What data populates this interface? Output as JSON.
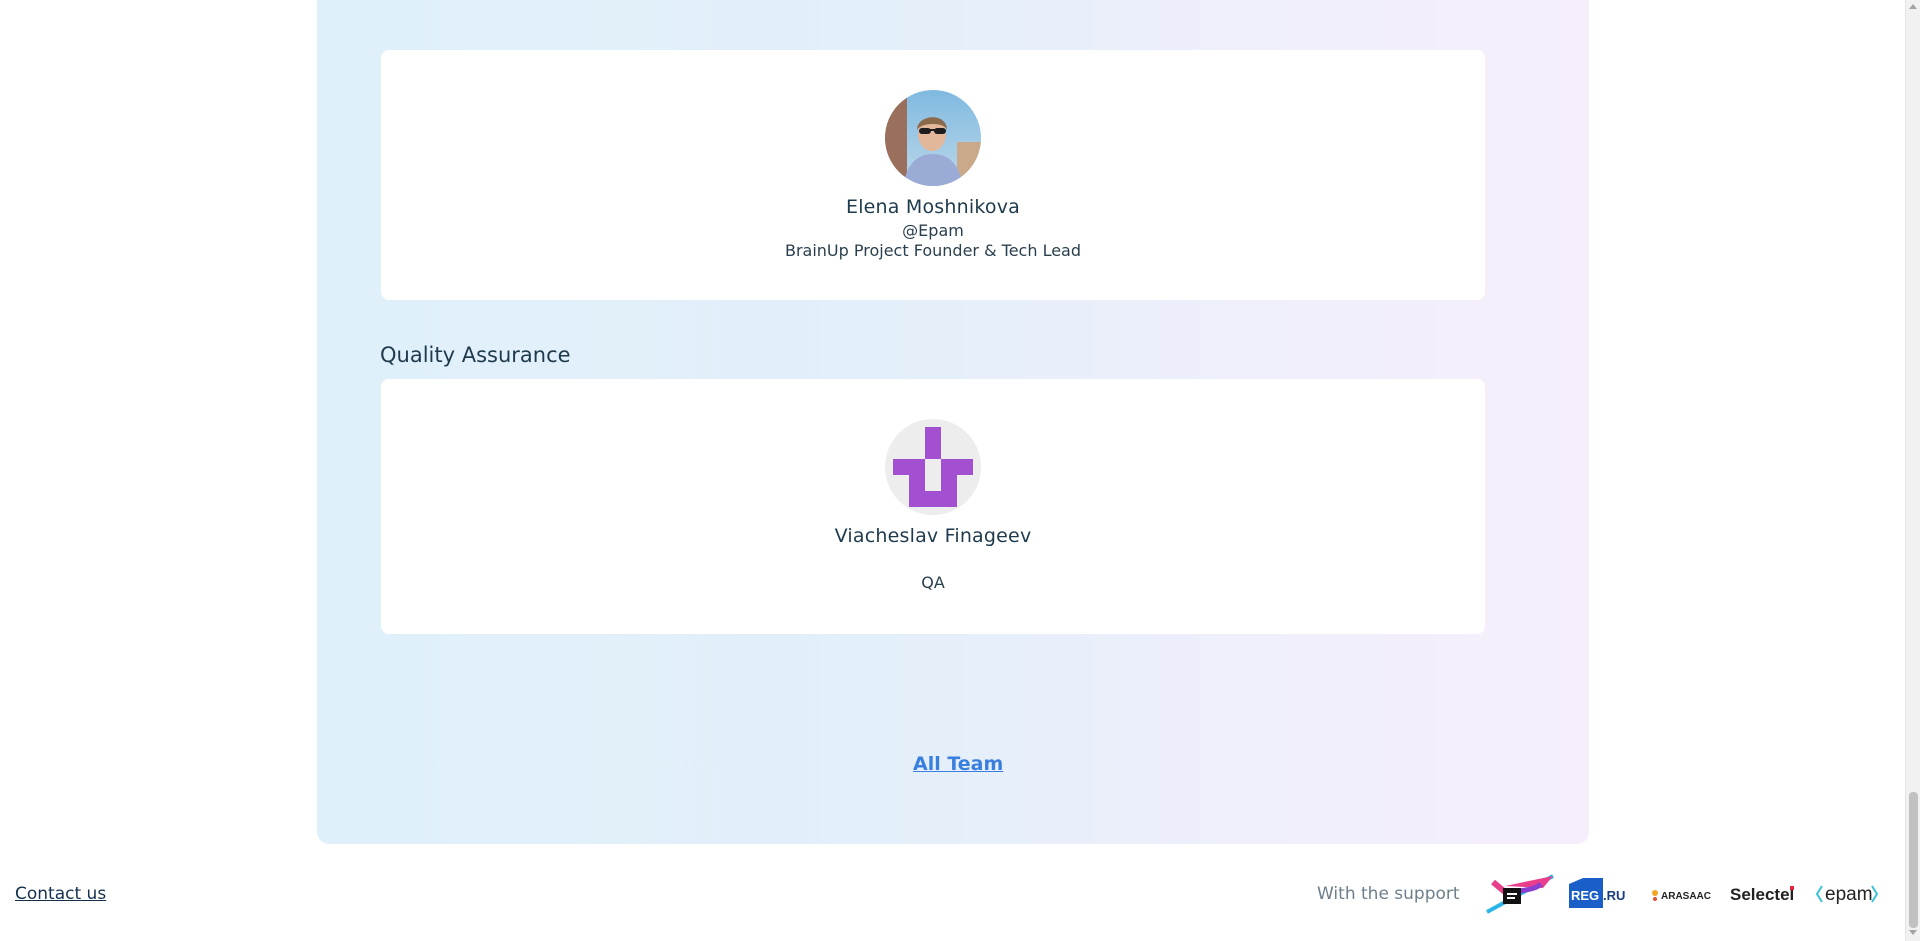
{
  "team": {
    "lead": {
      "name": "Elena Moshnikova",
      "company": "@Epam",
      "role": "BrainUp Project Founder & Tech Lead",
      "avatar_icon": "person-photo-icon"
    },
    "qa_section": {
      "heading": "Quality Assurance",
      "members": [
        {
          "name": "Viacheslav Finageev",
          "company": "",
          "role": "QA",
          "avatar_icon": "identicon-avatar-icon",
          "avatar_color": "#a24fd1"
        }
      ]
    },
    "all_team_link": "All Team"
  },
  "footer": {
    "contact_label": "Contact us",
    "support_label": "With the support",
    "sponsors": [
      {
        "name": "Moscow Digital Academy",
        "icon": "mda-logo-icon"
      },
      {
        "name": "REG.RU",
        "icon": "regru-logo-icon",
        "text_main": "REG",
        "text_tail": ".RU"
      },
      {
        "name": "ARASAAC",
        "icon": "arasaac-logo-icon",
        "text": "ARASAAC"
      },
      {
        "name": "Selectel",
        "icon": "selectel-logo-icon",
        "text": "Selectel"
      },
      {
        "name": "EPAM",
        "icon": "epam-logo-icon",
        "text": "epam"
      }
    ]
  },
  "colors": {
    "panel_gradient_start": "#e0f0fa",
    "panel_gradient_end": "#f6effb",
    "link_blue": "#3a7fe0",
    "heading_text": "#1e3a4c"
  }
}
